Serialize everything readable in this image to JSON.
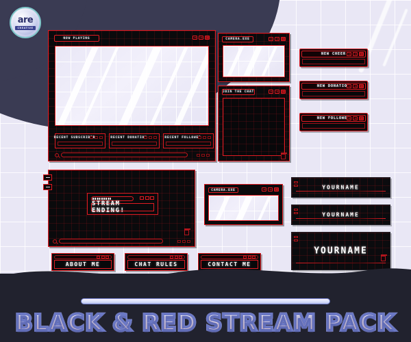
{
  "brand": {
    "logo_word": "are",
    "logo_sub": "CREATIVE",
    "logo_icon": "circular-badge-logo"
  },
  "banner": {
    "title": "BLACK & RED STREAM PACK",
    "rule_icon": "divider-rule"
  },
  "main_overlay": {
    "now_playing": {
      "title": "NOW PLAYING",
      "controls": [
        "minimize",
        "maximize",
        "close"
      ]
    },
    "recent_panels": [
      {
        "title": "RECENT SUBSCRIBER"
      },
      {
        "title": "RECENT DONATION"
      },
      {
        "title": "RECENT FOLLOWER"
      }
    ],
    "search_placeholder": "",
    "search_icon": "magnifier-icon"
  },
  "camera_panel": {
    "title": "CAMERA.EXE",
    "controls": [
      "minimize",
      "maximize",
      "close"
    ]
  },
  "chat_panel": {
    "title": "JOIN THE CHAT",
    "controls": [
      "minimize",
      "maximize",
      "close"
    ],
    "trash_icon": "trash-icon"
  },
  "alerts": [
    {
      "title": "NEW CHEER"
    },
    {
      "title": "NEW DONATION"
    },
    {
      "title": "NEW FOLLOWER"
    }
  ],
  "ending_screen": {
    "progress_label": "",
    "progress_percent": 45,
    "message": "STREAM ENDING!",
    "controls": [
      "minimize",
      "maximize",
      "close"
    ],
    "trash_icon": "trash-icon",
    "search_icon": "magnifier-icon"
  },
  "webcam_small": {
    "title": "CAMERA.EXE",
    "controls": [
      "minimize",
      "maximize",
      "close"
    ]
  },
  "cta_buttons": [
    {
      "label": "ABOUT ME"
    },
    {
      "label": "CHAT RULES"
    },
    {
      "label": "CONTACT ME"
    }
  ],
  "nameplates": [
    {
      "label": "YOURNAME",
      "size": "small"
    },
    {
      "label": "YOURNAME",
      "size": "small"
    },
    {
      "label": "YOURNAME",
      "size": "large"
    }
  ],
  "colors": {
    "accent_red": "#e01b22",
    "panel_black": "#0a0a0c",
    "background_lilac": "#e9e7f5",
    "dark_navy": "#3a3b53",
    "banner_dark": "#21222e"
  }
}
